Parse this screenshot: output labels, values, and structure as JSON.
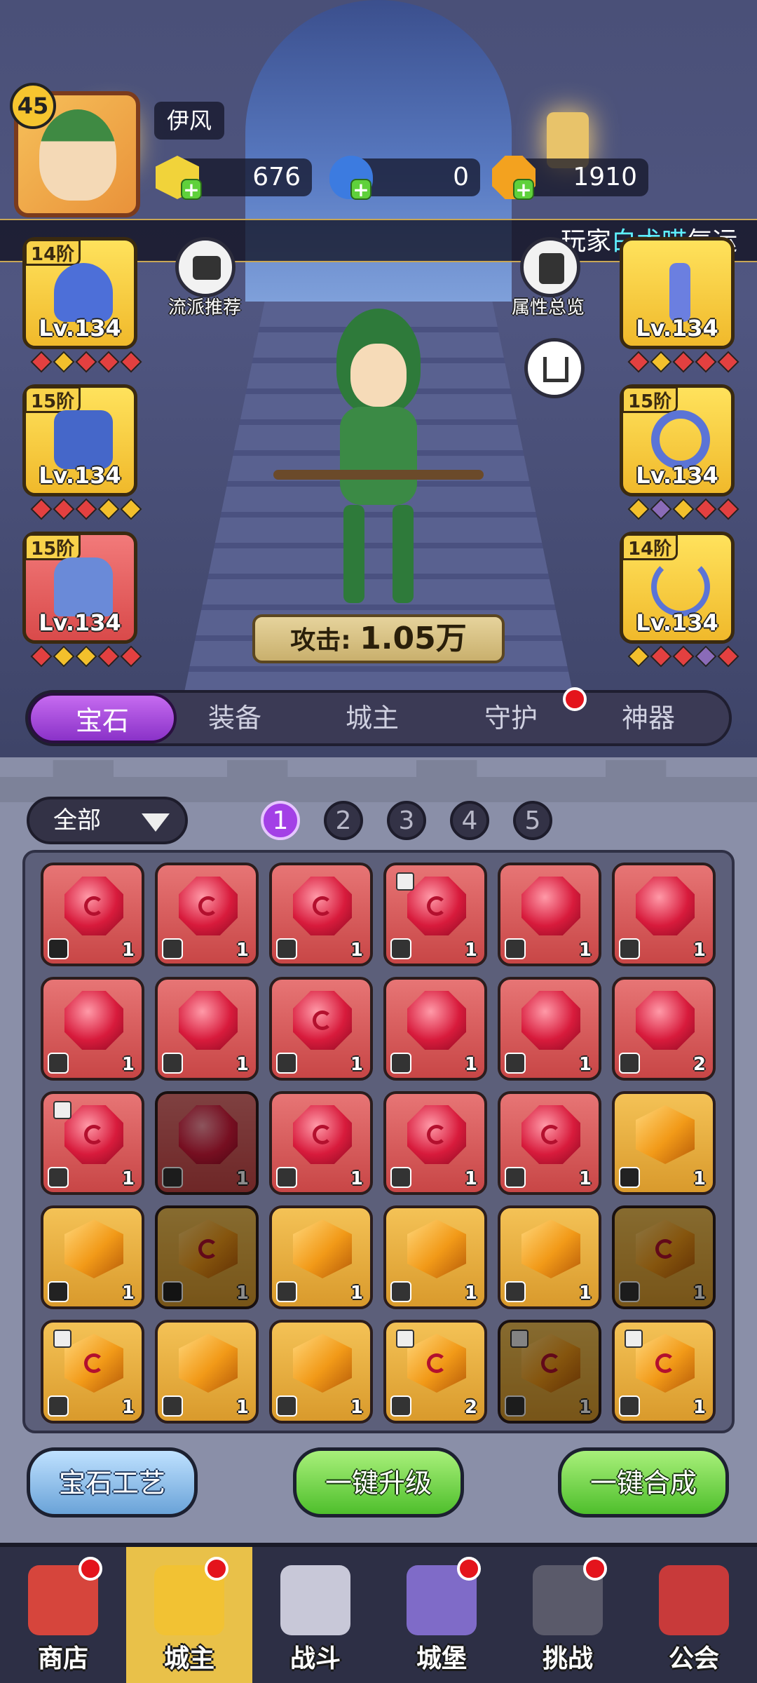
{
  "player": {
    "name": "伊风",
    "level": "45"
  },
  "resources": [
    {
      "icon": "gem-coin-icon",
      "value": "676",
      "color": "#f1d33a"
    },
    {
      "icon": "potion-icon",
      "value": "0",
      "color": "#3c7be0"
    },
    {
      "icon": "gold-coin-icon",
      "value": "1910",
      "color": "#f3a21f"
    }
  ],
  "banner": {
    "prefix": "玩家",
    "highlight": "白术喵",
    "suffix": "气运"
  },
  "side_buttons": {
    "recommend": "流派推荐",
    "attributes": "属性总览"
  },
  "equipment_left": [
    {
      "tier": "14阶",
      "level": "Lv.134",
      "icon": "wizard-hat-icon",
      "style": "yellow"
    },
    {
      "tier": "15阶",
      "level": "Lv.134",
      "icon": "armor-icon",
      "style": "yellow"
    },
    {
      "tier": "15阶",
      "level": "Lv.134",
      "icon": "boots-icon",
      "style": "red"
    }
  ],
  "equipment_right": [
    {
      "tier": "",
      "level": "Lv.134",
      "icon": "staff-icon",
      "style": "yellow"
    },
    {
      "tier": "15阶",
      "level": "Lv.134",
      "icon": "ring-icon",
      "style": "yellow"
    },
    {
      "tier": "14阶",
      "level": "Lv.134",
      "icon": "necklace-icon",
      "style": "yellow"
    }
  ],
  "attack": {
    "label": "攻击:",
    "value": "1.05万"
  },
  "tabs": [
    {
      "label": "宝石",
      "active": true
    },
    {
      "label": "装备",
      "active": false
    },
    {
      "label": "城主",
      "active": false
    },
    {
      "label": "守护",
      "active": false,
      "badge": true
    },
    {
      "label": "神器",
      "active": false
    }
  ],
  "filter": {
    "label": "全部"
  },
  "pages": [
    "1",
    "2",
    "3",
    "4",
    "5"
  ],
  "gems": [
    {
      "color": "red",
      "count": "1",
      "swirl": true,
      "slot": "crown-icon"
    },
    {
      "color": "red",
      "count": "1",
      "swirl": true,
      "slot": "shirt-icon"
    },
    {
      "color": "red",
      "count": "1",
      "swirl": true,
      "slot": "shirt-icon"
    },
    {
      "color": "red",
      "count": "1",
      "swirl": true,
      "slot": "shirt-icon",
      "locked": true
    },
    {
      "color": "red",
      "count": "1",
      "swirl": false,
      "slot": "boot-icon"
    },
    {
      "color": "red",
      "count": "1",
      "swirl": false,
      "slot": "boot-icon"
    },
    {
      "color": "red",
      "count": "1",
      "swirl": false,
      "slot": "boot-icon"
    },
    {
      "color": "red",
      "count": "1",
      "swirl": false,
      "slot": "boot-icon"
    },
    {
      "color": "red",
      "count": "1",
      "swirl": true,
      "slot": "axe-icon"
    },
    {
      "color": "red",
      "count": "1",
      "swirl": false,
      "slot": "axe-icon"
    },
    {
      "color": "red",
      "count": "1",
      "swirl": false,
      "slot": "ring-icon"
    },
    {
      "color": "red",
      "count": "2",
      "swirl": false,
      "slot": "ring-icon"
    },
    {
      "color": "red",
      "count": "1",
      "swirl": true,
      "slot": "ring-icon",
      "locked": true
    },
    {
      "color": "red",
      "count": "1",
      "swirl": false,
      "slot": "necklace-icon",
      "dim": true
    },
    {
      "color": "red",
      "count": "1",
      "swirl": true,
      "slot": "necklace-icon"
    },
    {
      "color": "red",
      "count": "1",
      "swirl": true,
      "slot": "necklace-icon"
    },
    {
      "color": "red",
      "count": "1",
      "swirl": true,
      "slot": "necklace-icon"
    },
    {
      "color": "orange",
      "count": "1",
      "swirl": false,
      "slot": "crown-icon"
    },
    {
      "color": "orange",
      "count": "1",
      "swirl": false,
      "slot": "crown-icon"
    },
    {
      "color": "orange",
      "count": "1",
      "swirl": true,
      "slot": "crown-icon",
      "dim": true
    },
    {
      "color": "orange",
      "count": "1",
      "swirl": false,
      "slot": "shirt-icon"
    },
    {
      "color": "orange",
      "count": "1",
      "swirl": false,
      "slot": "shirt-icon"
    },
    {
      "color": "orange",
      "count": "1",
      "swirl": false,
      "slot": "shirt-icon"
    },
    {
      "color": "orange",
      "count": "1",
      "swirl": true,
      "slot": "shirt-icon",
      "dim": true
    },
    {
      "color": "orange",
      "count": "1",
      "swirl": true,
      "slot": "axe-icon",
      "locked": true
    },
    {
      "color": "orange",
      "count": "1",
      "swirl": false,
      "slot": "axe-icon"
    },
    {
      "color": "orange",
      "count": "1",
      "swirl": false,
      "slot": "axe-icon"
    },
    {
      "color": "orange",
      "count": "2",
      "swirl": true,
      "slot": "axe-icon",
      "locked": true
    },
    {
      "color": "orange",
      "count": "1",
      "swirl": true,
      "slot": "axe-icon",
      "locked": true,
      "dim": true
    },
    {
      "color": "orange",
      "count": "1",
      "swirl": true,
      "slot": "axe-icon",
      "locked": true
    }
  ],
  "actions": {
    "craft": "宝石工艺",
    "upgrade": "一键升级",
    "merge": "一键合成"
  },
  "nav": [
    {
      "label": "商店",
      "icon": "shop-icon",
      "badge": true,
      "active": false
    },
    {
      "label": "城主",
      "icon": "crown-icon",
      "badge": true,
      "active": true
    },
    {
      "label": "战斗",
      "icon": "swords-icon",
      "badge": false,
      "active": false
    },
    {
      "label": "城堡",
      "icon": "castle-icon",
      "badge": true,
      "active": false
    },
    {
      "label": "挑战",
      "icon": "monster-icon",
      "badge": true,
      "active": false
    },
    {
      "label": "公会",
      "icon": "guild-banner-icon",
      "badge": false,
      "active": false
    }
  ]
}
